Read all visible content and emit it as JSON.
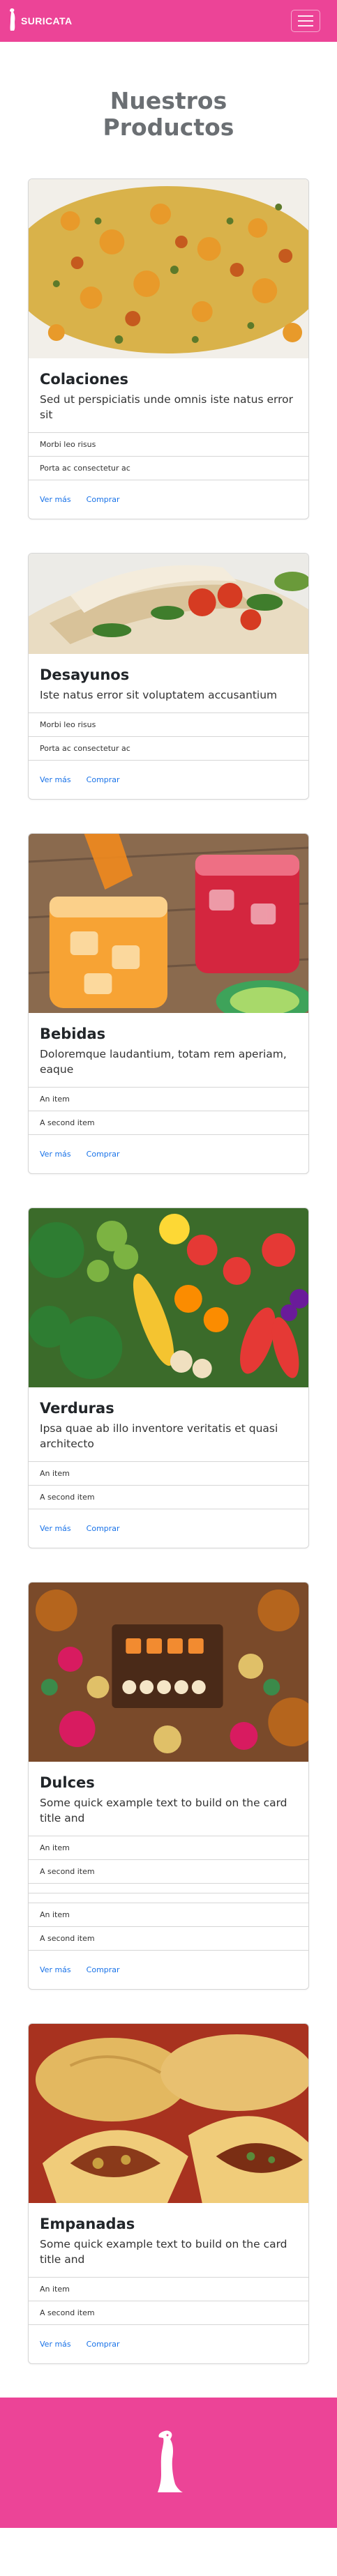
{
  "navbar": {
    "brand": "SURICATA",
    "menu_icon": "hamburger-icon",
    "logo_icon": "meerkat-icon"
  },
  "page": {
    "title_line1": "Nuestros",
    "title_line2": "Productos"
  },
  "cards": [
    {
      "title": "Colaciones",
      "text": "Sed ut perspiciatis unde omnis iste natus error sit",
      "items": [
        "Morbi leo risus",
        "Porta ac consectetur ac"
      ],
      "link_more": "Ver más",
      "link_buy": "Comprar"
    },
    {
      "title": "Desayunos",
      "text": "Iste natus error sit voluptatem accusantium",
      "items": [
        "Morbi leo risus",
        "Porta ac consectetur ac"
      ],
      "link_more": "Ver más",
      "link_buy": "Comprar"
    },
    {
      "title": "Bebidas",
      "text": "Doloremque laudantium, totam rem aperiam, eaque",
      "items": [
        "An item",
        "A second item"
      ],
      "link_more": "Ver más",
      "link_buy": "Comprar"
    },
    {
      "title": "Verduras",
      "text": "Ipsa quae ab illo inventore veritatis et quasi architecto",
      "items": [
        "An item",
        "A second item"
      ],
      "link_more": "Ver más",
      "link_buy": "Comprar"
    },
    {
      "title": "Dulces",
      "text": "Some quick example text to build on the card title and",
      "items": [
        "An item",
        "A second item",
        "An item",
        "A second item"
      ],
      "link_more": "Ver más",
      "link_buy": "Comprar"
    },
    {
      "title": "Empanadas",
      "text": "Some quick example text to build on the card title and",
      "items": [
        "An item",
        "A second item"
      ],
      "link_more": "Ver más",
      "link_buy": "Comprar"
    }
  ],
  "colors": {
    "brand_pink": "#ec4497",
    "link_blue": "#1a73e8",
    "title_gray": "#6b6f73"
  }
}
